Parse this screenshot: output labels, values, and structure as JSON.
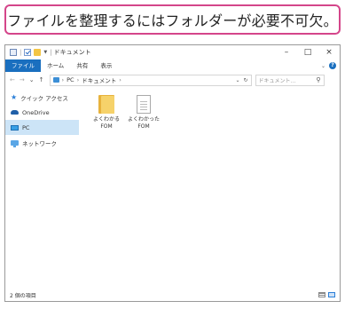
{
  "caption": {
    "text": "ファイルを整理するにはフォルダーが必要不可欠。"
  },
  "window": {
    "title": "ドキュメント",
    "controls": {
      "minimize": "–",
      "maximize": "□",
      "close": "×"
    }
  },
  "ribbon": {
    "tabs": [
      {
        "label": "ファイル"
      },
      {
        "label": "ホーム"
      },
      {
        "label": "共有"
      },
      {
        "label": "表示"
      }
    ],
    "help": "?"
  },
  "address": {
    "back": "←",
    "forward": "→",
    "recent": "⌄",
    "up": "↑",
    "crumbs": [
      {
        "label": "PC"
      },
      {
        "label": "ドキュメント"
      }
    ],
    "separator": "›",
    "refresh": "↻",
    "dropdown": "⌄",
    "search_placeholder": "ドキュメント... ",
    "search_icon": "⚲"
  },
  "nav_pane": {
    "items": [
      {
        "label": "クイック アクセス",
        "icon": "star-icon"
      },
      {
        "label": "OneDrive",
        "icon": "cloud-icon"
      },
      {
        "label": "PC",
        "icon": "monitor-icon",
        "selected": true
      },
      {
        "label": "ネットワーク",
        "icon": "network-icon"
      }
    ]
  },
  "files": [
    {
      "name": "よくわかる\nFOM",
      "type": "folder"
    },
    {
      "name": "よくわかった\nFOM",
      "type": "document"
    }
  ],
  "status": {
    "count": "2 個の項目"
  },
  "colors": {
    "accent": "#1a6fbf",
    "caption_border": "#d4458a",
    "selected": "#cce4f7",
    "folder": "#f6d26a"
  }
}
